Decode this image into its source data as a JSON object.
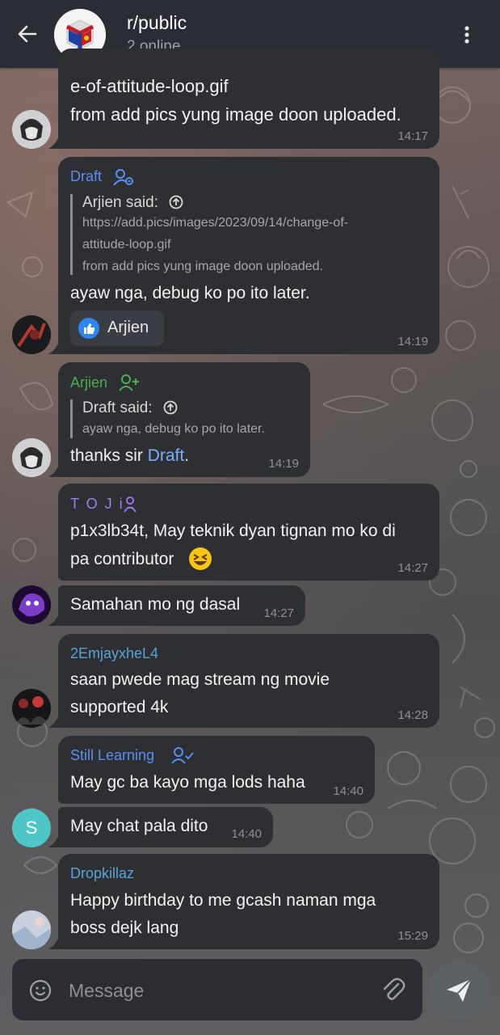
{
  "header": {
    "title": "r/public",
    "subtitle": "2 online",
    "back_icon": "arrow-left-icon",
    "menu_icon": "more-vertical-icon"
  },
  "colors": {
    "bubble": "#2d2f33",
    "header": "#2a2d33",
    "draft": "#5a8ff0",
    "arjien": "#4caf50",
    "toji": "#a47cf0",
    "emjay": "#57a3d8",
    "still": "#5a8ff0",
    "drop": "#57a3d8"
  },
  "messages": [
    {
      "line1": "e-of-attitude-loop.gif",
      "line2": "from add pics yung image doon uploaded.",
      "time": "14:17"
    },
    {
      "sender": "Draft",
      "quote_name": "Arjien said:",
      "quote_lines": [
        "https://add.pics/images/2023/09/14/change-of-",
        "attitude-loop.gif",
        "from add pics yung image doon uploaded."
      ],
      "text": "ayaw nga, debug ko po ito later.",
      "reaction_name": "Arjien",
      "time": "14:19"
    },
    {
      "sender": "Arjien",
      "quote_name": "Draft said:",
      "quote_line": "ayaw nga, debug ko po ito later.",
      "text_prefix": "thanks sir ",
      "mention": "Draft",
      "text_suffix": ".",
      "time": "14:19"
    },
    {
      "sender": "T O J i",
      "line1": "p1x3lb34t, May teknik dyan tignan mo ko di",
      "line2": "pa contributor",
      "time": "14:27"
    },
    {
      "text": "Samahan mo ng dasal",
      "time": "14:27"
    },
    {
      "sender": "2EmjayxheL4",
      "line1": "saan pwede mag stream ng movie",
      "line2": "supported 4k",
      "time": "14:28"
    },
    {
      "sender": "Still Learning",
      "text": "May gc ba kayo mga lods haha",
      "time": "14:40"
    },
    {
      "avatar_letter": "S",
      "text": "May chat pala dito",
      "time": "14:40"
    },
    {
      "sender": "Dropkillaz",
      "line1": "Happy birthday to me gcash naman mga",
      "line2": "boss dejk lang",
      "time": "15:29"
    }
  ],
  "input": {
    "placeholder": "Message",
    "emoji_icon": "emoji-icon",
    "attach_icon": "paperclip-icon",
    "send_icon": "send-icon"
  }
}
